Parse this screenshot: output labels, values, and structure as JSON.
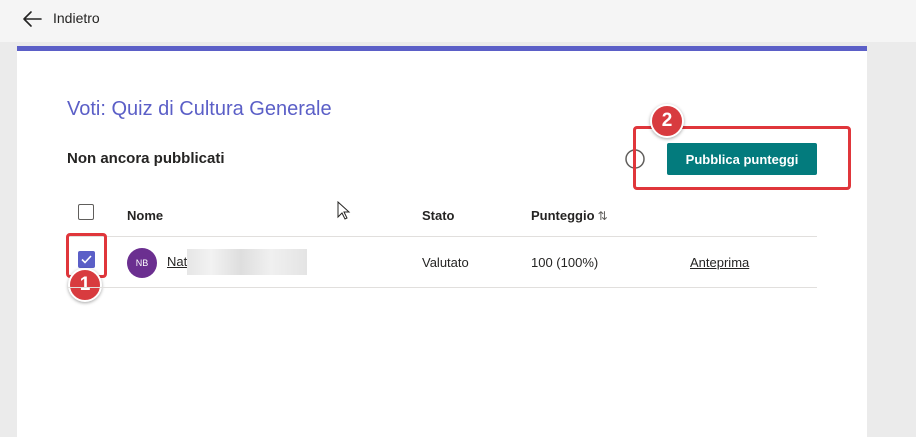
{
  "header": {
    "back_label": "Indietro"
  },
  "page": {
    "title": "Voti: Quiz di Cultura Generale",
    "section_title": "Non ancora pubblicati",
    "publish_button": "Pubblica punteggi"
  },
  "table": {
    "columns": [
      "Nome",
      "Stato",
      "Punteggio"
    ],
    "rows": [
      {
        "avatar_initials": "NB",
        "name": "Nat",
        "status": "Valutato",
        "score": "100 (100%)",
        "action": "Anteprima",
        "checked": true
      }
    ]
  },
  "callouts": [
    "1",
    "2"
  ],
  "colors": {
    "accent": "#5b5fc7",
    "publish_button": "#037b7d",
    "callout": "#e0363b",
    "avatar": "#6b2f90"
  },
  "icons": [
    "back-arrow-icon",
    "info-icon",
    "sort-icon",
    "checkmark-icon",
    "mouse-cursor-icon"
  ]
}
